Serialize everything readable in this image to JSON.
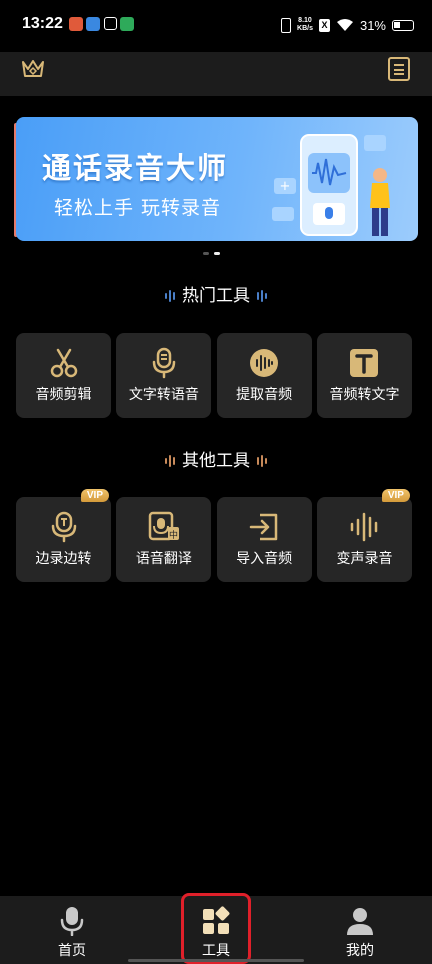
{
  "status_bar": {
    "time": "13:22",
    "net_speed_value": "8.10",
    "net_speed_unit": "KB/s",
    "sim_label": "X",
    "battery": "31%"
  },
  "banner": {
    "title": "通话录音大师",
    "subtitle": "轻松上手  玩转录音",
    "pages": 2,
    "active_page": 2
  },
  "hot_tools": {
    "title": "热门工具",
    "items": [
      {
        "label": "音频剪辑",
        "icon": "scissors-icon"
      },
      {
        "label": "文字转语音",
        "icon": "microphone-icon"
      },
      {
        "label": "提取音频",
        "icon": "waveform-icon"
      },
      {
        "label": "音频转文字",
        "icon": "text-T-icon"
      }
    ]
  },
  "other_tools": {
    "title": "其他工具",
    "items": [
      {
        "label": "边录边转",
        "icon": "mic-text-icon",
        "badge": "VIP"
      },
      {
        "label": "语音翻译",
        "icon": "mic-translate-icon"
      },
      {
        "label": "导入音频",
        "icon": "import-icon"
      },
      {
        "label": "变声录音",
        "icon": "voice-wave-icon",
        "badge": "VIP"
      }
    ]
  },
  "bottom_nav": {
    "items": [
      {
        "label": "首页",
        "icon": "microphone-icon"
      },
      {
        "label": "工具",
        "icon": "tools-grid-icon",
        "active": true
      },
      {
        "label": "我的",
        "icon": "user-icon"
      }
    ]
  },
  "colors": {
    "accent_gold": "#d8b878",
    "card_bg": "#262626",
    "highlight_red": "#e0202a"
  }
}
